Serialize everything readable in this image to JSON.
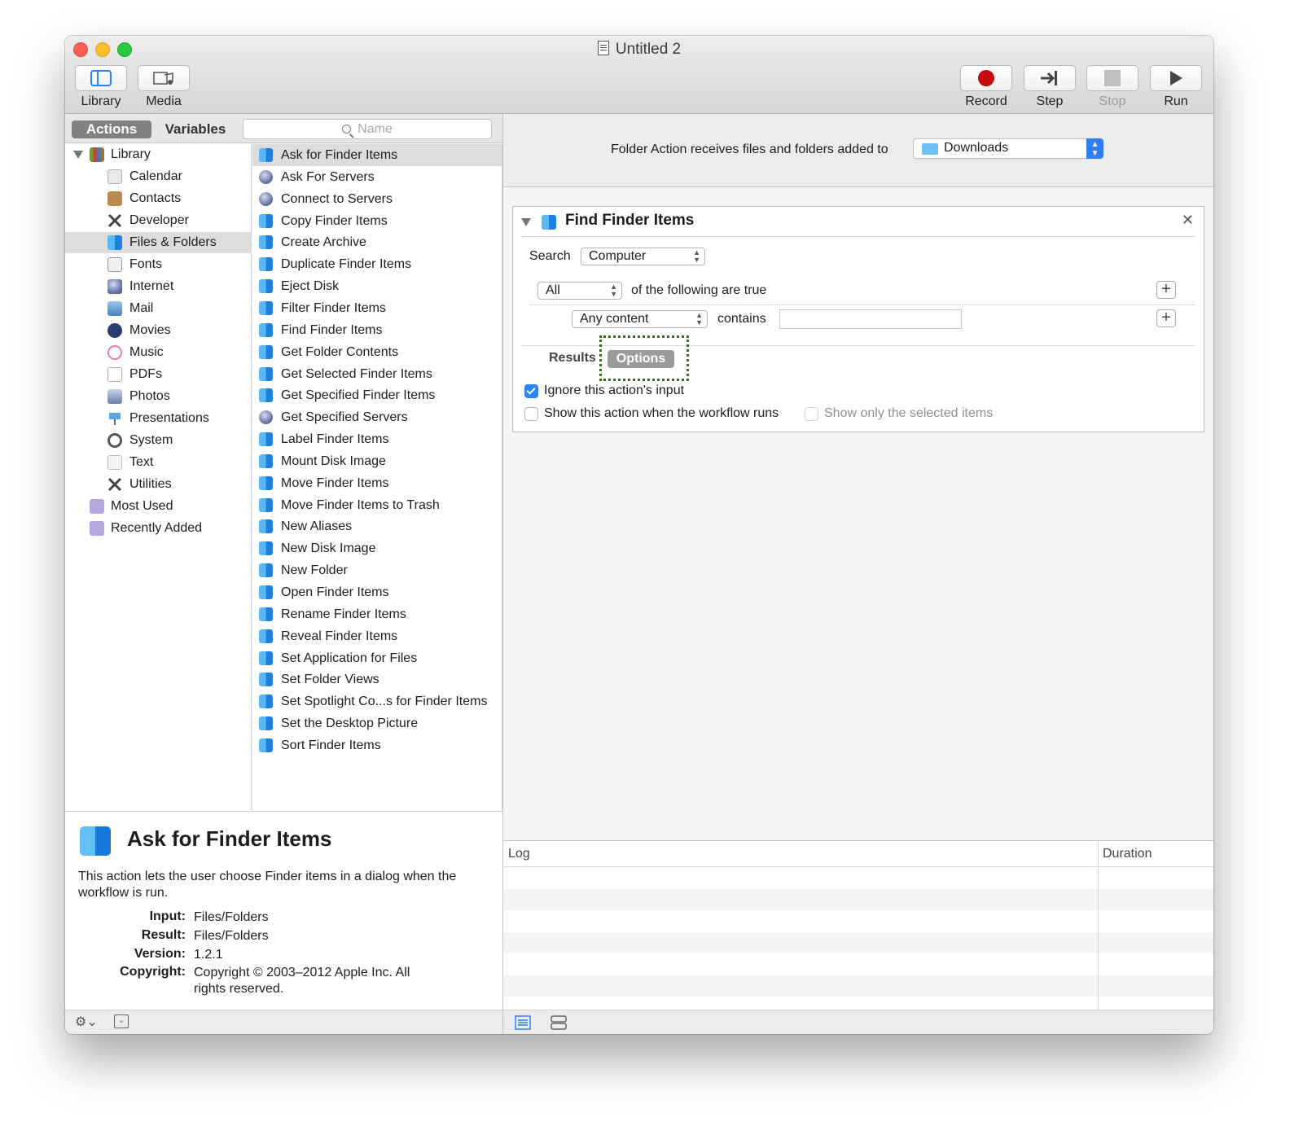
{
  "window": {
    "title": "Untitled 2"
  },
  "toolbar": {
    "library_label": "Library",
    "media_label": "Media",
    "record_label": "Record",
    "step_label": "Step",
    "stop_label": "Stop",
    "run_label": "Run",
    "record_color": "#c40a0a"
  },
  "left_header": {
    "actions_tab": "Actions",
    "variables_tab": "Variables",
    "search_placeholder": "Name"
  },
  "library": {
    "root_label": "Library",
    "categories": [
      {
        "label": "Calendar",
        "icon": "calendar-icon",
        "color": "#e8e8e8"
      },
      {
        "label": "Contacts",
        "icon": "contacts-icon",
        "color": "#b98a4f"
      },
      {
        "label": "Developer",
        "icon": "developer-icon",
        "color": "#444444"
      },
      {
        "label": "Files & Folders",
        "icon": "finder-icon",
        "color": "#2a8ae6"
      },
      {
        "label": "Fonts",
        "icon": "fonts-icon",
        "color": "#777777"
      },
      {
        "label": "Internet",
        "icon": "internet-icon",
        "color": "#5a6a9c"
      },
      {
        "label": "Mail",
        "icon": "mail-icon",
        "color": "#6aa0d8"
      },
      {
        "label": "Movies",
        "icon": "movies-icon",
        "color": "#2c3e6b"
      },
      {
        "label": "Music",
        "icon": "music-icon",
        "color": "#e87ab5"
      },
      {
        "label": "PDFs",
        "icon": "pdfs-icon",
        "color": "#dddddd"
      },
      {
        "label": "Photos",
        "icon": "photos-icon",
        "color": "#8a9cc0"
      },
      {
        "label": "Presentations",
        "icon": "presentations-icon",
        "color": "#5aa5e0"
      },
      {
        "label": "System",
        "icon": "system-icon",
        "color": "#555555"
      },
      {
        "label": "Text",
        "icon": "text-icon",
        "color": "#e9e9e9"
      },
      {
        "label": "Utilities",
        "icon": "utilities-icon",
        "color": "#444444"
      }
    ],
    "most_used": "Most Used",
    "recently_added": "Recently Added"
  },
  "actions_list": [
    {
      "label": "Ask for Finder Items",
      "icon": "finder"
    },
    {
      "label": "Ask For Servers",
      "icon": "globe"
    },
    {
      "label": "Connect to Servers",
      "icon": "globe"
    },
    {
      "label": "Copy Finder Items",
      "icon": "finder"
    },
    {
      "label": "Create Archive",
      "icon": "finder"
    },
    {
      "label": "Duplicate Finder Items",
      "icon": "finder"
    },
    {
      "label": "Eject Disk",
      "icon": "finder"
    },
    {
      "label": "Filter Finder Items",
      "icon": "finder"
    },
    {
      "label": "Find Finder Items",
      "icon": "finder"
    },
    {
      "label": "Get Folder Contents",
      "icon": "finder"
    },
    {
      "label": "Get Selected Finder Items",
      "icon": "finder"
    },
    {
      "label": "Get Specified Finder Items",
      "icon": "finder"
    },
    {
      "label": "Get Specified Servers",
      "icon": "globe"
    },
    {
      "label": "Label Finder Items",
      "icon": "finder"
    },
    {
      "label": "Mount Disk Image",
      "icon": "finder"
    },
    {
      "label": "Move Finder Items",
      "icon": "finder"
    },
    {
      "label": "Move Finder Items to Trash",
      "icon": "finder"
    },
    {
      "label": "New Aliases",
      "icon": "finder"
    },
    {
      "label": "New Disk Image",
      "icon": "finder"
    },
    {
      "label": "New Folder",
      "icon": "finder"
    },
    {
      "label": "Open Finder Items",
      "icon": "finder"
    },
    {
      "label": "Rename Finder Items",
      "icon": "finder"
    },
    {
      "label": "Reveal Finder Items",
      "icon": "finder"
    },
    {
      "label": "Set Application for Files",
      "icon": "finder"
    },
    {
      "label": "Set Folder Views",
      "icon": "finder"
    },
    {
      "label": "Set Spotlight Co...s for Finder Items",
      "icon": "finder"
    },
    {
      "label": "Set the Desktop Picture",
      "icon": "finder"
    },
    {
      "label": "Sort Finder Items",
      "icon": "finder"
    }
  ],
  "description": {
    "title": "Ask for Finder Items",
    "text": "This action lets the user choose Finder items in a dialog when the workflow is run.",
    "input_key": "Input:",
    "input_val": "Files/Folders",
    "result_key": "Result:",
    "result_val": "Files/Folders",
    "version_key": "Version:",
    "version_val": "1.2.1",
    "copyright_key": "Copyright:",
    "copyright_val": "Copyright © 2003–2012 Apple Inc.  All rights reserved."
  },
  "folder_action": {
    "label": "Folder Action receives files and folders added to",
    "folder": "Downloads"
  },
  "action_card": {
    "title": "Find Finder Items",
    "search_label": "Search",
    "search_scope": "Computer",
    "match_mode": "All",
    "match_text": "of the following are true",
    "criterion_field": "Any content",
    "criterion_op": "contains",
    "criterion_value": "",
    "results_tab": "Results",
    "options_tab": "Options",
    "ignore_input_label": "Ignore this action's input",
    "ignore_input_checked": true,
    "show_action_label": "Show this action when the workflow runs",
    "show_action_checked": false,
    "show_selected_label": "Show only the selected items",
    "show_selected_checked": false
  },
  "log": {
    "log_header": "Log",
    "duration_header": "Duration"
  }
}
